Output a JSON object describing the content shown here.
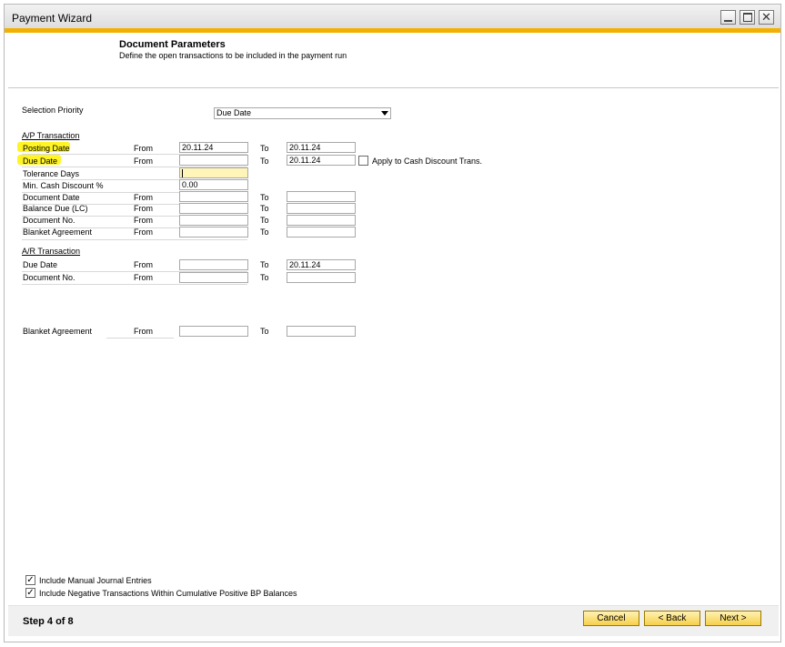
{
  "window": {
    "title": "Payment Wizard"
  },
  "header": {
    "title": "Document Parameters",
    "description": "Define the open transactions to be included in the payment run"
  },
  "selection_priority": {
    "label": "Selection Priority",
    "value": "Due Date"
  },
  "ap": {
    "section_title": "A/P Transaction",
    "rows": [
      {
        "label": "Posting Date",
        "from_label": "From",
        "from": "20.11.24",
        "to_label": "To",
        "to": "20.11.24"
      },
      {
        "label": "Due Date",
        "from_label": "From",
        "from": "",
        "to_label": "To",
        "to": "20.11.24"
      }
    ],
    "apply_cash_discount": {
      "label": "Apply to Cash Discount Trans.",
      "checked": false
    },
    "tolerance_days": {
      "label": "Tolerance Days",
      "value": ""
    },
    "min_cash_discount": {
      "label": "Min. Cash Discount %",
      "value": "0.00"
    },
    "more_rows": [
      {
        "label": "Document Date",
        "from_label": "From",
        "from": "",
        "to_label": "To",
        "to": ""
      },
      {
        "label": "Balance Due (LC)",
        "from_label": "From",
        "from": "",
        "to_label": "To",
        "to": ""
      },
      {
        "label": "Document No.",
        "from_label": "From",
        "from": "",
        "to_label": "To",
        "to": ""
      },
      {
        "label": "Blanket Agreement",
        "from_label": "From",
        "from": "",
        "to_label": "To",
        "to": ""
      }
    ]
  },
  "ar": {
    "section_title": "A/R Transaction",
    "rows": [
      {
        "label": "Due Date",
        "from_label": "From",
        "from": "",
        "to_label": "To",
        "to": "20.11.24"
      },
      {
        "label": "Document No.",
        "from_label": "From",
        "from": "",
        "to_label": "To",
        "to": ""
      }
    ]
  },
  "blanket": {
    "label": "Blanket Agreement",
    "from_label": "From",
    "from": "",
    "to_label": "To",
    "to": ""
  },
  "options": {
    "manual_journal": {
      "label": "Include Manual Journal Entries",
      "checked": true
    },
    "negative_trans": {
      "label": "Include Negative Transactions Within Cumulative Positive BP Balances",
      "checked": true
    }
  },
  "footer": {
    "step": "Step 4 of 8",
    "cancel": "Cancel",
    "back": "< Back",
    "next": "Next >"
  },
  "colors": {
    "accent": "#f2b000",
    "highlight": "#fff200",
    "button": "#f6cf4a"
  }
}
